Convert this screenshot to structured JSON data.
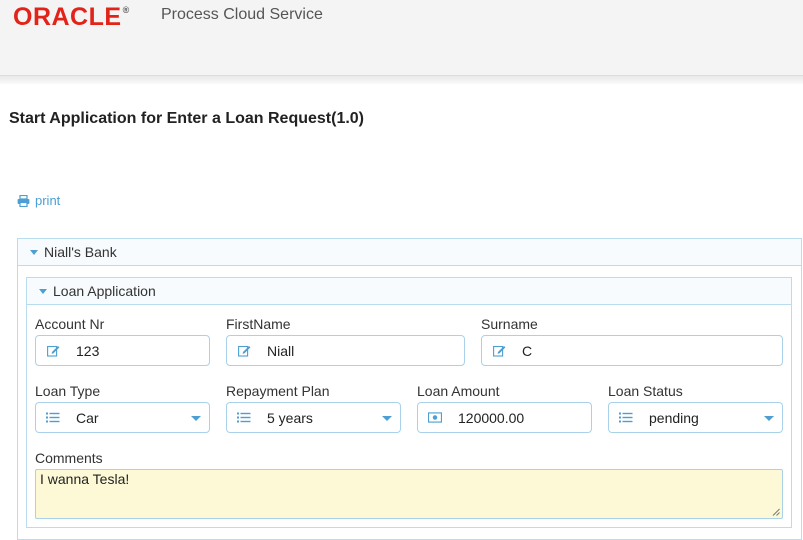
{
  "header": {
    "logo": "ORACLE",
    "registered": "®",
    "product": "Process Cloud Service"
  },
  "page": {
    "title": "Start Application for Enter a Loan Request(1.0)",
    "print_label": "print"
  },
  "sections": {
    "outer_title": "Niall's Bank",
    "inner_title": "Loan Application"
  },
  "form": {
    "account_nr": {
      "label": "Account Nr",
      "value": "123",
      "icon": "edit-icon"
    },
    "first_name": {
      "label": "FirstName",
      "value": "Niall",
      "icon": "edit-icon"
    },
    "surname": {
      "label": "Surname",
      "value": "C",
      "icon": "edit-icon"
    },
    "loan_type": {
      "label": "Loan Type",
      "value": "Car",
      "icon": "list-icon"
    },
    "repayment_plan": {
      "label": "Repayment Plan",
      "value": "5 years",
      "icon": "list-icon"
    },
    "loan_amount": {
      "label": "Loan Amount",
      "value": "120000.00",
      "icon": "money-icon"
    },
    "loan_status": {
      "label": "Loan Status",
      "value": "pending",
      "icon": "list-icon"
    },
    "comments": {
      "label": "Comments",
      "value": "I wanna Tesla!"
    }
  },
  "colors": {
    "brand": "#e2231a",
    "accent": "#4d9ed3",
    "border": "#a9d2ea",
    "comment_bg": "#fdf9d6"
  }
}
